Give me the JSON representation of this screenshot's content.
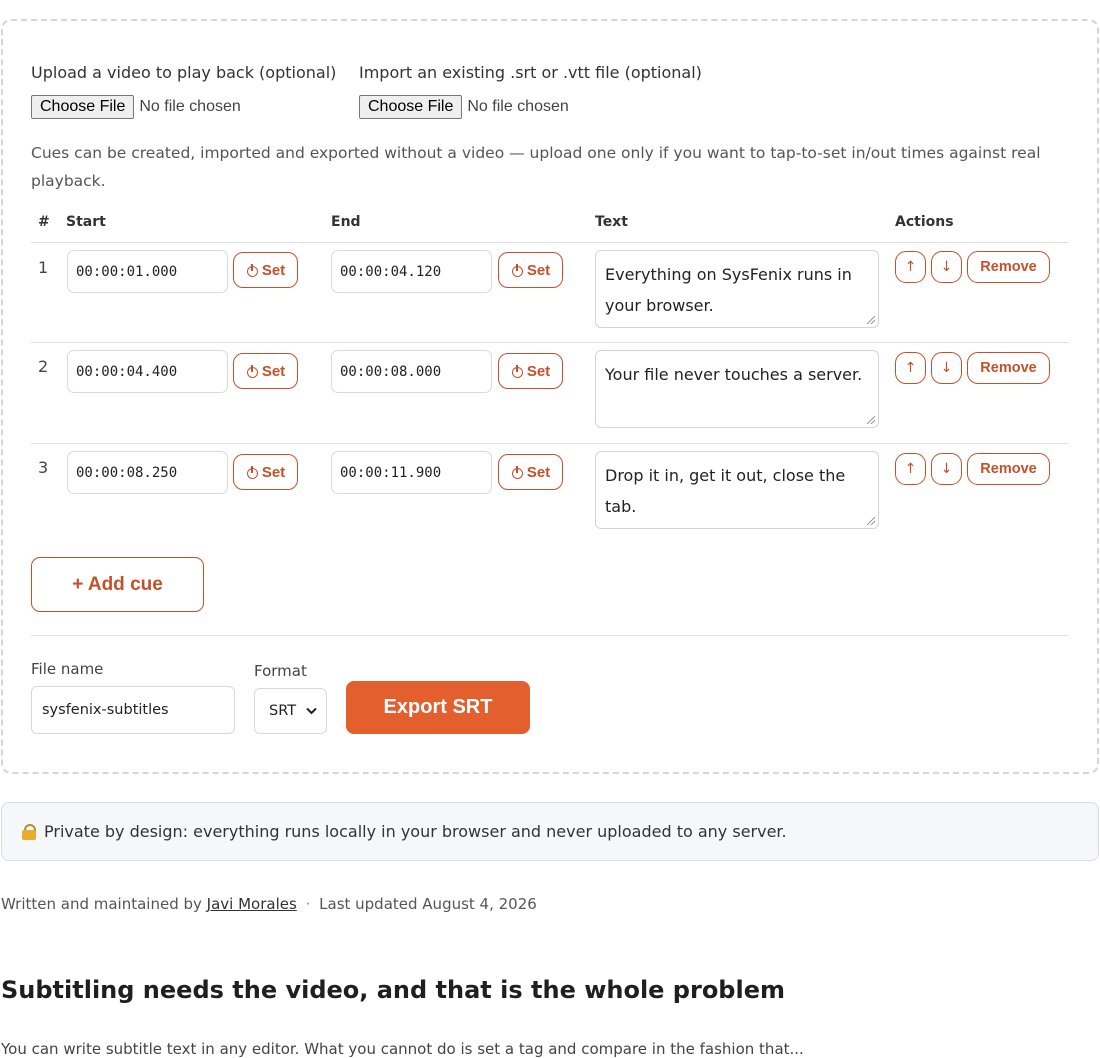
{
  "upload": {
    "video_label": "Upload a video to play back (optional)",
    "import_label": "Import an existing .srt or .vtt file (optional)",
    "choose_file": "Choose File",
    "no_file": "No file chosen"
  },
  "note": "Cues can be created, imported and exported without a video — upload one only if you want to tap-to-set in/out times against real playback.",
  "table": {
    "headers": {
      "num": "#",
      "start": "Start",
      "end": "End",
      "text": "Text",
      "actions": "Actions"
    },
    "set_label": "Set",
    "up_label": "↑",
    "down_label": "↓",
    "remove_label": "Remove",
    "rows": [
      {
        "num": "1",
        "start": "00:00:01.000",
        "end": "00:00:04.120",
        "text": "Everything on SysFenix runs in your browser."
      },
      {
        "num": "2",
        "start": "00:00:04.400",
        "end": "00:00:08.000",
        "text": "Your file never touches a server."
      },
      {
        "num": "3",
        "start": "00:00:08.250",
        "end": "00:00:11.900",
        "text": "Drop it in, get it out, close the tab."
      }
    ]
  },
  "add_cue_label": "+ Add cue",
  "export": {
    "file_name_label": "File name",
    "file_name_value": "sysfenix-subtitles",
    "format_label": "Format",
    "format_value": "SRT",
    "export_label": "Export SRT"
  },
  "privacy": "Private by design: everything runs locally in your browser and never uploaded to any server.",
  "byline": {
    "prefix": "Written and maintained by",
    "author": "Javi Morales",
    "separator": "·",
    "updated": "Last updated August 4, 2026"
  },
  "article": {
    "heading": "Subtitling needs the video, and that is the whole problem",
    "para_start": "You can write subtitle text in any editor. What you cannot do is set a tag and compare in the fashion that..."
  },
  "colors": {
    "accent": "#c5502a",
    "export_bg": "#e35f2e"
  }
}
